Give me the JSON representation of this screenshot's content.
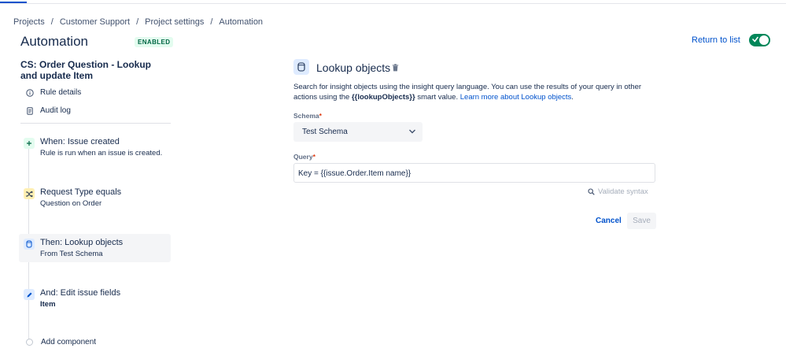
{
  "breadcrumb": [
    "Projects",
    "Customer Support",
    "Project settings",
    "Automation"
  ],
  "header": {
    "title": "Automation",
    "status": "ENABLED",
    "return_label": "Return to list",
    "toggle_on": true
  },
  "rule": {
    "title": "CS: Order Question - Lookup and update Item",
    "links": {
      "details": "Rule details",
      "audit": "Audit log"
    }
  },
  "components": [
    {
      "title": "When: Issue created",
      "subtitle": "Rule is run when an issue is created.",
      "icon": "plus-icon",
      "color": "#E3FCEF"
    },
    {
      "title": "Request Type equals",
      "subtitle": "Question on Order",
      "icon": "shuffle-icon",
      "color": "#FFF0B3"
    },
    {
      "title": "Then: Lookup objects",
      "subtitle": "From Test Schema",
      "icon": "cylinder-icon",
      "color": "#DEEBFF"
    },
    {
      "title": "And: Edit issue fields",
      "subtitle": "Item",
      "icon": "pencil-icon",
      "color": "#DEEBFF"
    }
  ],
  "add_component": "Add component",
  "panel": {
    "title": "Lookup objects",
    "desc_part1": "Search for insight objects using the insight query language. You can use the results of your query in other actions using the ",
    "desc_smart": "{{lookupObjects}}",
    "desc_part2": " smart value. ",
    "desc_link": "Learn more about Lookup objects",
    "desc_end": ".",
    "schema_label": "Schema",
    "schema_value": "Test Schema",
    "query_label": "Query",
    "query_value": "Key = {{issue.Order.Item name}}",
    "required_mark": "*",
    "validate": "Validate syntax",
    "cancel": "Cancel",
    "save": "Save"
  },
  "colors": {
    "accent": "#0052CC",
    "enabled": "#00875A"
  }
}
